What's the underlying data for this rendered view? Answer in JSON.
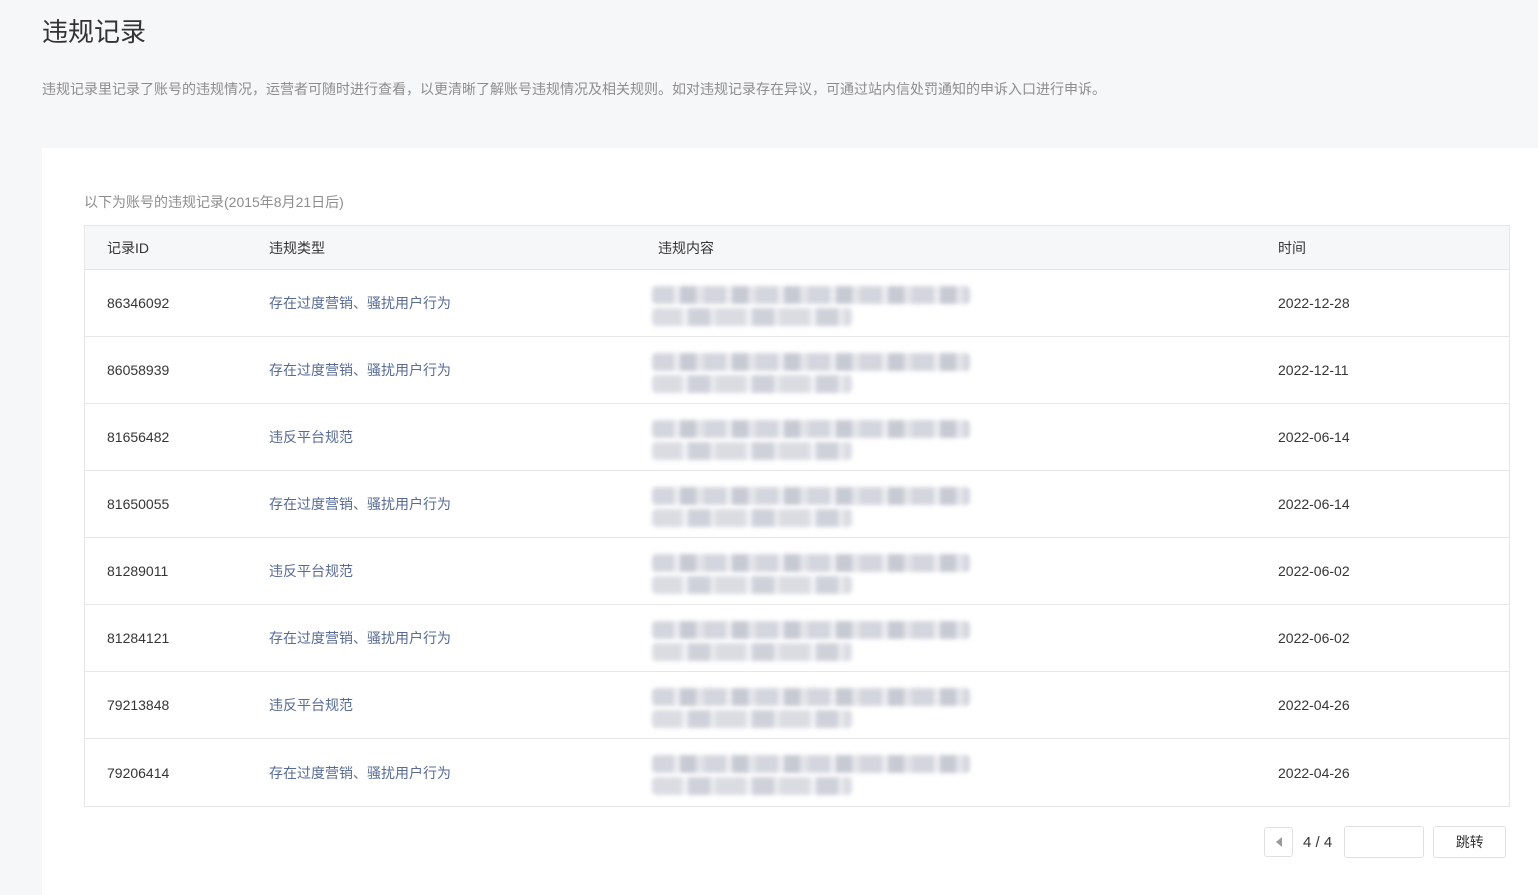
{
  "header": {
    "title": "违规记录",
    "description": "违规记录里记录了账号的违规情况，运营者可随时进行查看，以更清晰了解账号违规情况及相关规则。如对违规记录存在异议，可通过站内信处罚通知的申诉入口进行申诉。"
  },
  "records": {
    "caption": "以下为账号的违规记录(2015年8月21日后)",
    "columns": {
      "id": "记录ID",
      "type": "违规类型",
      "content": "违规内容",
      "time": "时间"
    },
    "rows": [
      {
        "id": "86346092",
        "type": "存在过度营销、骚扰用户行为",
        "time": "2022-12-28"
      },
      {
        "id": "86058939",
        "type": "存在过度营销、骚扰用户行为",
        "time": "2022-12-11"
      },
      {
        "id": "81656482",
        "type": "违反平台规范",
        "time": "2022-06-14"
      },
      {
        "id": "81650055",
        "type": "存在过度营销、骚扰用户行为",
        "time": "2022-06-14"
      },
      {
        "id": "81289011",
        "type": "违反平台规范",
        "time": "2022-06-02"
      },
      {
        "id": "81284121",
        "type": "存在过度营销、骚扰用户行为",
        "time": "2022-06-02"
      },
      {
        "id": "79213848",
        "type": "违反平台规范",
        "time": "2022-04-26"
      },
      {
        "id": "79206414",
        "type": "存在过度营销、骚扰用户行为",
        "time": "2022-04-26"
      }
    ]
  },
  "pagination": {
    "page_text": "4 / 4",
    "jump_input_value": "",
    "jump_label": "跳转"
  },
  "colors": {
    "link": "#576b95",
    "background": "#f6f7f9"
  }
}
